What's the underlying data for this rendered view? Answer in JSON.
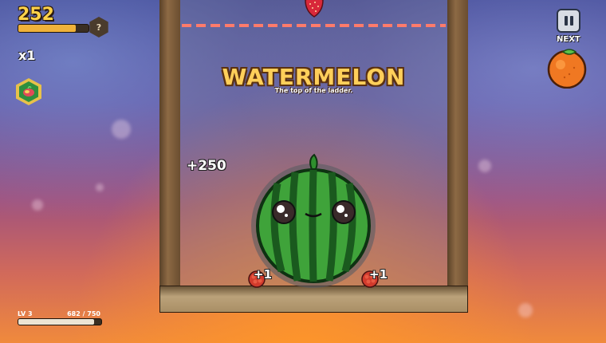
{
  "hud": {
    "score": "252",
    "score_progress": 0.82,
    "help_label": "?",
    "multiplier": "x1",
    "level_label": "LV 3",
    "xp_text": "682 / 750",
    "xp_progress": 0.909
  },
  "banner": {
    "title": "WATERMELON",
    "subtitle": "The top of the ladder."
  },
  "popups": {
    "main_points": "+250",
    "left_points": "+1",
    "right_points": "+1"
  },
  "controls": {
    "next_label": "NEXT"
  },
  "pieces": {
    "dropping": "strawberry-icon",
    "next": "orange-icon",
    "merged": "watermelon-icon",
    "powerup": "fruit-bomb-icon"
  },
  "colors": {
    "score": "#ffd24a",
    "title": "#ffcf5a",
    "watermelon": "#3fa33a",
    "orange": "#f07822",
    "dashline": "#ff7b6b"
  }
}
